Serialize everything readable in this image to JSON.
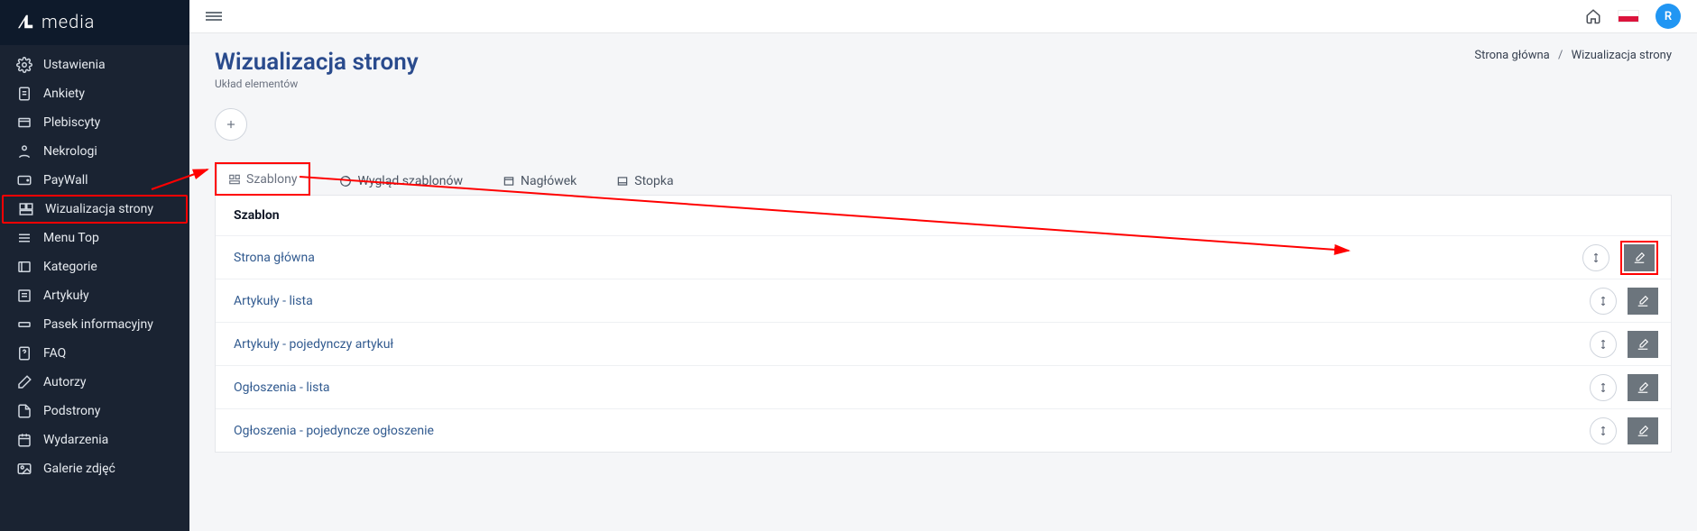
{
  "brand": {
    "text": "media"
  },
  "sidebar": {
    "items": [
      {
        "label": "Ustawienia"
      },
      {
        "label": "Ankiety"
      },
      {
        "label": "Plebiscyty"
      },
      {
        "label": "Nekrologi"
      },
      {
        "label": "PayWall"
      },
      {
        "label": "Wizualizacja strony"
      },
      {
        "label": "Menu Top"
      },
      {
        "label": "Kategorie"
      },
      {
        "label": "Artykuły"
      },
      {
        "label": "Pasek informacyjny"
      },
      {
        "label": "FAQ"
      },
      {
        "label": "Autorzy"
      },
      {
        "label": "Podstrony"
      },
      {
        "label": "Wydarzenia"
      },
      {
        "label": "Galerie zdjęć"
      }
    ]
  },
  "topbar": {
    "avatar_initial": "R"
  },
  "page": {
    "title": "Wizualizacja strony",
    "subtitle": "Układ elementów",
    "breadcrumb": {
      "root": "Strona główna",
      "current": "Wizualizacja strony"
    }
  },
  "tabs": [
    {
      "label": "Szablony"
    },
    {
      "label": "Wygląd szablonów"
    },
    {
      "label": "Nagłówek"
    },
    {
      "label": "Stopka"
    }
  ],
  "table": {
    "column": "Szablon",
    "rows": [
      {
        "name": "Strona główna",
        "highlighted": true
      },
      {
        "name": "Artykuły - lista"
      },
      {
        "name": "Artykuły - pojedynczy artykuł"
      },
      {
        "name": "Ogłoszenia - lista"
      },
      {
        "name": "Ogłoszenia - pojedyncze ogłoszenie"
      }
    ]
  }
}
